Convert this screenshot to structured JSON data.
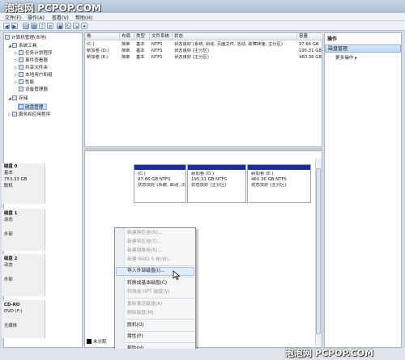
{
  "watermark_top": "泡泡网 PCPOP.COM",
  "watermark_bottom": "泡泡网 PCPOP.COM",
  "menu": [
    "文件(F)",
    "操作(A)",
    "查看(V)",
    "帮助(H)"
  ],
  "tree": {
    "root": "计算机管理(本地)",
    "system_tools": "系统工具",
    "task_scheduler": "任务计划程序",
    "event_viewer": "事件查看器",
    "shared_folders": "共享文件夹",
    "local_users": "本地用户和组",
    "performance": "性能",
    "device_manager": "设备管理器",
    "storage": "存储",
    "disk_management": "磁盘管理",
    "services": "服务和应用程序"
  },
  "grid": {
    "headers": [
      "卷",
      "布局",
      "类型",
      "文件系统",
      "状态",
      "容量"
    ],
    "rows": [
      [
        "(C:)",
        "简单",
        "基本",
        "NTFS",
        "状态良好 (系统, 启动, 页面文件, 活动, 故障转储, 主分区)",
        "97.66 GB"
      ],
      [
        "新加卷 (D:)",
        "简单",
        "基本",
        "NTFS",
        "状态良好 (主分区)",
        "195.31 GB"
      ],
      [
        "新加卷 (E:)",
        "简单",
        "基本",
        "NTFS",
        "状态良好 (主分区)",
        "460.36 GB"
      ]
    ]
  },
  "disks": {
    "disk0": {
      "name": "磁盘 0",
      "type": "基本",
      "size": "753.33 GB",
      "state": "联机"
    },
    "disk1": {
      "name": "磁盘 1",
      "type": "动态",
      "state": "外部"
    },
    "disk2": {
      "name": "磁盘 2",
      "type": "动态",
      "state": "外部"
    },
    "cdrom": {
      "name": "CD-RO",
      "type": "DVD (F:)",
      "state": "无媒体"
    },
    "partitions": [
      {
        "name": "(C:)",
        "size": "97.66 GB NTFS",
        "status": "状态良好 (系统, 启动, 页"
      },
      {
        "name": "新加卷 (D:)",
        "size": "195.31 GB NTFS",
        "status": "状态良好 (主分区)"
      },
      {
        "name": "新加卷 (E:)",
        "size": "460.36 GB NTFS",
        "status": "状态良好 (主分区)"
      }
    ],
    "legend": "未分配"
  },
  "actions": {
    "header": "操作",
    "item": "磁盘管理",
    "more": "更多操作"
  },
  "context_menu": [
    {
      "label": "新建跨区卷(N)...",
      "disabled": true
    },
    {
      "label": "新建带区卷(T)...",
      "disabled": true
    },
    {
      "label": "新建镜像卷(R)...",
      "disabled": true
    },
    {
      "label": "新建 RAID-5 卷(W)...",
      "disabled": true
    },
    {
      "label": "导入外部磁盘(I)...",
      "disabled": false
    },
    {
      "label": "转换成基本磁盘(C)",
      "disabled": false
    },
    {
      "label": "转换成 GPT 磁盘(V)",
      "disabled": true
    },
    {
      "label": "重新激活磁盘(A)",
      "disabled": true
    },
    {
      "label": "删除磁盘(M)",
      "disabled": true
    },
    {
      "label": "脱机(O)",
      "disabled": false
    },
    {
      "label": "属性(P)",
      "disabled": false
    },
    {
      "label": "帮助(H)",
      "disabled": false
    }
  ],
  "colors": {
    "partition_bar": "#1c2f8f",
    "highlight": "#cde2f7"
  }
}
